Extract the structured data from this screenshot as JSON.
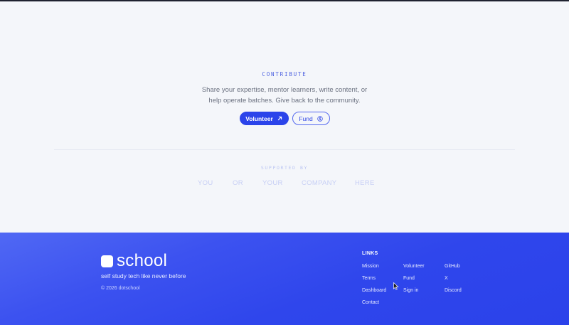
{
  "contribute": {
    "eyebrow": "CONTRIBUTE",
    "description_line1": "Share your expertise, mentor learners, write content, or",
    "description_line2": "help operate batches. Give back to the community.",
    "volunteer_label": "Volunteer",
    "fund_label": "Fund"
  },
  "supported": {
    "label": "SUPPORTED BY",
    "sponsors": [
      "YOU",
      "OR",
      "YOUR",
      "COMPANY",
      "HERE"
    ]
  },
  "footer": {
    "brand_name": "school",
    "tagline": "self study tech like never before",
    "copyright": "© 2026 dotschool",
    "links_title": "LINKS",
    "links": {
      "col1": [
        "Mission",
        "Terms",
        "Dashboard",
        "Contact"
      ],
      "col2": [
        "Volunteer",
        "Fund",
        "Sign in"
      ],
      "col3": [
        "GitHub",
        "X",
        "Discord"
      ]
    }
  },
  "colors": {
    "accent": "#2b44ea",
    "footer_bg": "#3047ec",
    "page_bg": "#f4f6fa"
  },
  "icons": {
    "volunteer": "arrow-up-right-icon",
    "fund": "dollar-circle-icon",
    "brand": "logo-square-icon"
  }
}
